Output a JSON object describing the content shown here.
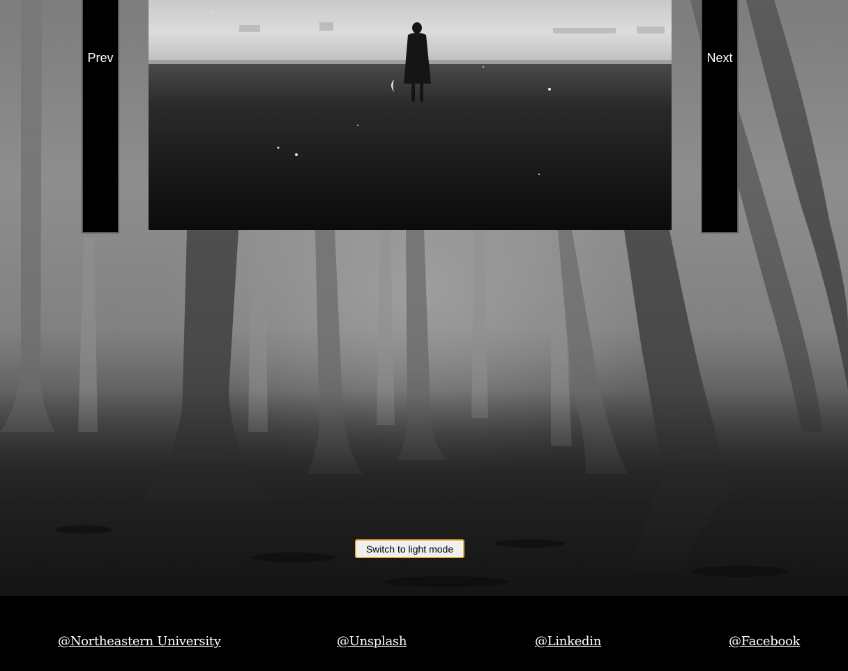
{
  "slider": {
    "prev_label": "Prev",
    "next_label": "Next"
  },
  "theme_toggle": {
    "label": "Switch to light mode"
  },
  "footer": {
    "links": [
      {
        "label": "@Northeastern University"
      },
      {
        "label": "@Unsplash"
      },
      {
        "label": "@Linkedin"
      },
      {
        "label": "@Facebook"
      }
    ]
  },
  "colors": {
    "nav_button_bg": "#000000",
    "footer_bg": "#000000",
    "toggle_border": "#e6a93c",
    "text_light": "#ffffff"
  }
}
